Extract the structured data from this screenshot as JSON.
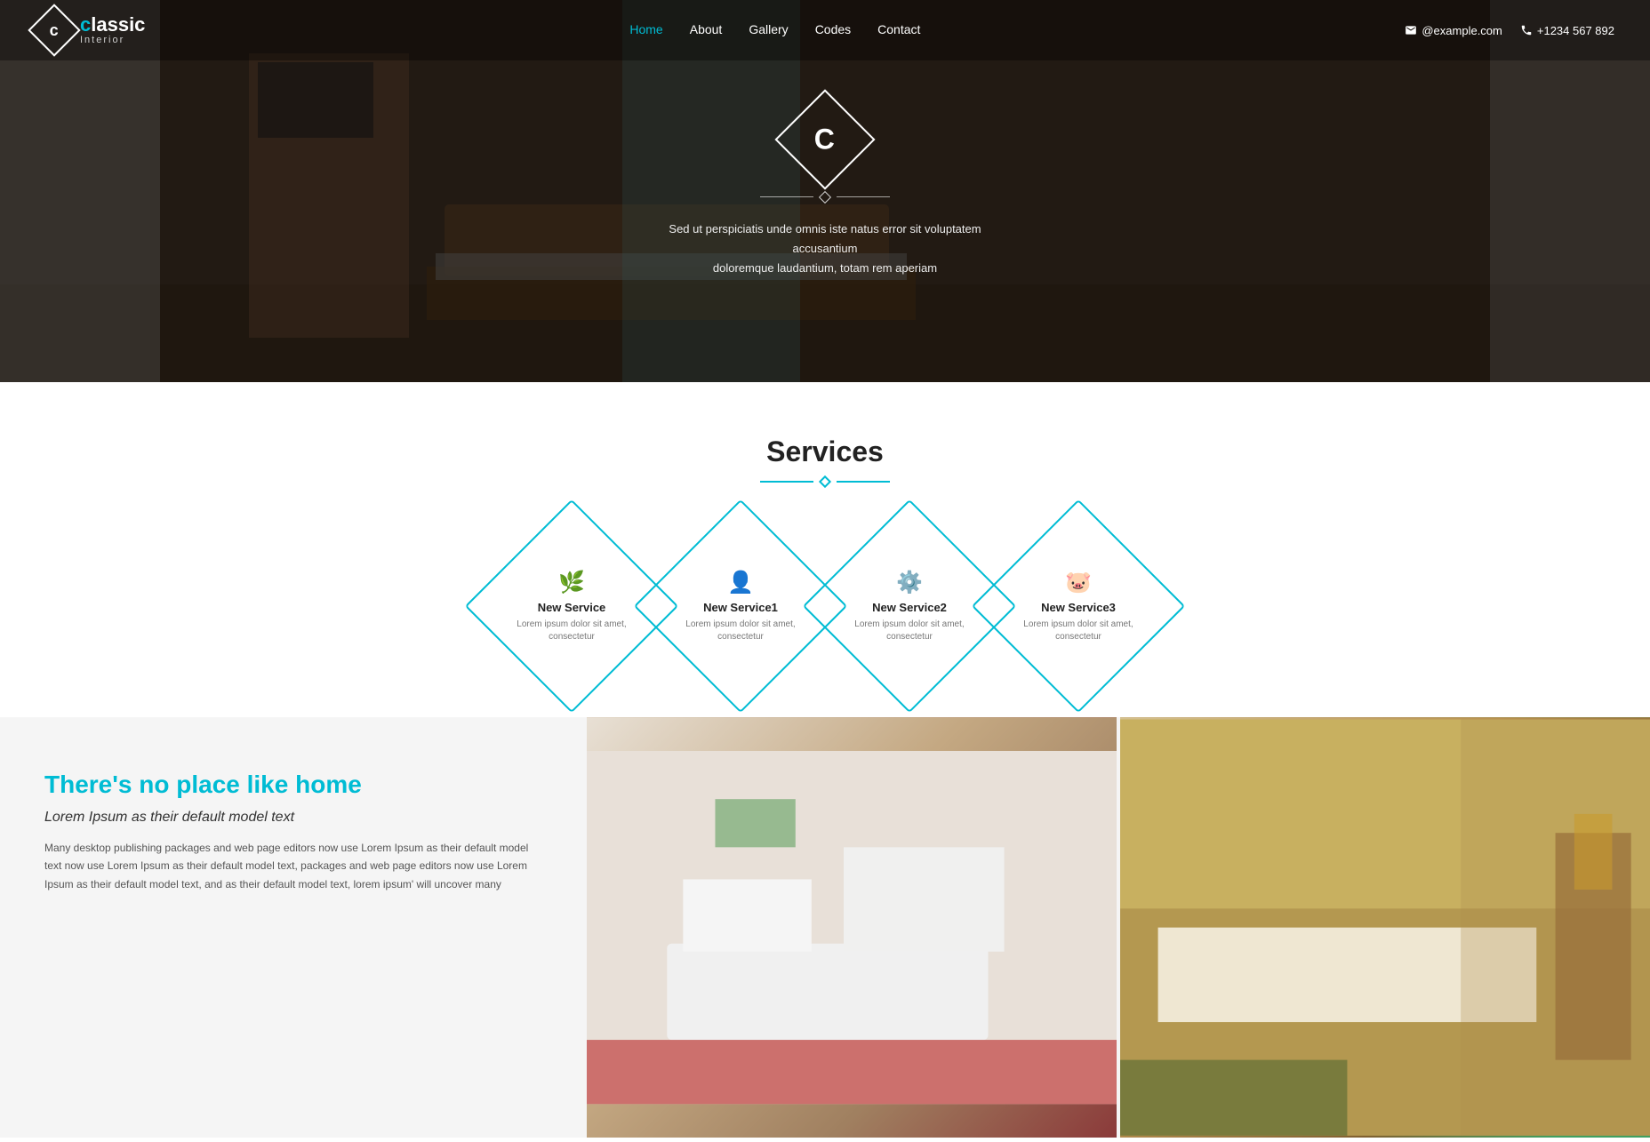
{
  "navbar": {
    "logo_letter": "c",
    "logo_brand": "lassic",
    "logo_sub": "Interior",
    "nav_links": [
      {
        "label": "Home",
        "active": true
      },
      {
        "label": "About",
        "active": false
      },
      {
        "label": "Gallery",
        "active": false
      },
      {
        "label": "Codes",
        "active": false
      },
      {
        "label": "Contact",
        "active": false
      }
    ],
    "email": "@example.com",
    "phone": "+1234 567 892"
  },
  "hero": {
    "logo_letter": "C",
    "text_line1": "Sed ut perspiciatis unde omnis iste natus error sit voluptatem accusantium",
    "text_line2": "doloremque laudantium, totam rem aperiam"
  },
  "services": {
    "section_title": "Services",
    "cards": [
      {
        "icon": "🌿",
        "name": "New Service",
        "desc": "Lorem ipsum dolor sit amet, consectetur"
      },
      {
        "icon": "👤",
        "name": "New Service1",
        "desc": "Lorem ipsum dolor sit amet, consectetur"
      },
      {
        "icon": "⚙️",
        "name": "New Service2",
        "desc": "Lorem ipsum dolor sit amet, consectetur"
      },
      {
        "icon": "🐷",
        "name": "New Service3",
        "desc": "Lorem ipsum dolor sit amet, consectetur"
      }
    ]
  },
  "about": {
    "title": "There's no place like home",
    "subtitle": "Lorem Ipsum as their default model text",
    "body": "Many desktop publishing packages and web page editors now use Lorem Ipsum as their default model text now use Lorem Ipsum as their default model text, packages and web page editors now use Lorem Ipsum as their default model text, and as their default model text, lorem ipsum' will uncover many"
  }
}
